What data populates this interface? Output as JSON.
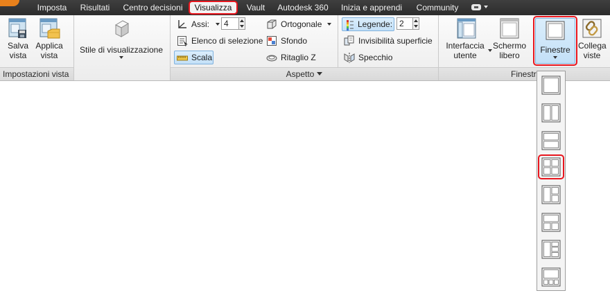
{
  "tabs": [
    {
      "label": "Imposta"
    },
    {
      "label": "Risultati"
    },
    {
      "label": "Centro decisioni"
    },
    {
      "label": "Visualizza",
      "active": true
    },
    {
      "label": "Vault"
    },
    {
      "label": "Autodesk 360"
    },
    {
      "label": "Inizia e apprendi"
    },
    {
      "label": "Community"
    }
  ],
  "panels": {
    "impostazioni_vista": {
      "title": "Impostazioni vista",
      "salva_vista": "Salva vista",
      "applica_vista": "Applica vista"
    },
    "stile": {
      "label": "Stile di visualizzazione"
    },
    "aspetto": {
      "title": "Aspetto",
      "assi_label": "Assi:",
      "assi_value": "4",
      "elenco_selezione": "Elenco di selezione",
      "scala": "Scala",
      "ortogonale": "Ortogonale",
      "sfondo": "Sfondo",
      "ritaglio_z": "Ritaglio Z",
      "legende_label": "Legende:",
      "legende_value": "2",
      "invisibilita_superficie": "Invisibilità superficie",
      "specchio": "Specchio"
    },
    "finestre": {
      "title": "Finestre",
      "interfaccia_utente": "Interfaccia utente",
      "schermo_libero": "Schermo libero",
      "finestre": "Finestre",
      "collega_viste": "Collega viste"
    }
  },
  "window_layouts": [
    {
      "name": "single"
    },
    {
      "name": "two-vertical"
    },
    {
      "name": "two-horizontal"
    },
    {
      "name": "four-grid",
      "highlighted": true
    },
    {
      "name": "one-left-two-right"
    },
    {
      "name": "one-top-two-bottom"
    },
    {
      "name": "one-left-three-right"
    },
    {
      "name": "one-top-three-bottom"
    }
  ],
  "colors": {
    "highlight": "#e8151d",
    "selected_fill": "#c3e0f7",
    "app_orange": "#e8811c"
  }
}
